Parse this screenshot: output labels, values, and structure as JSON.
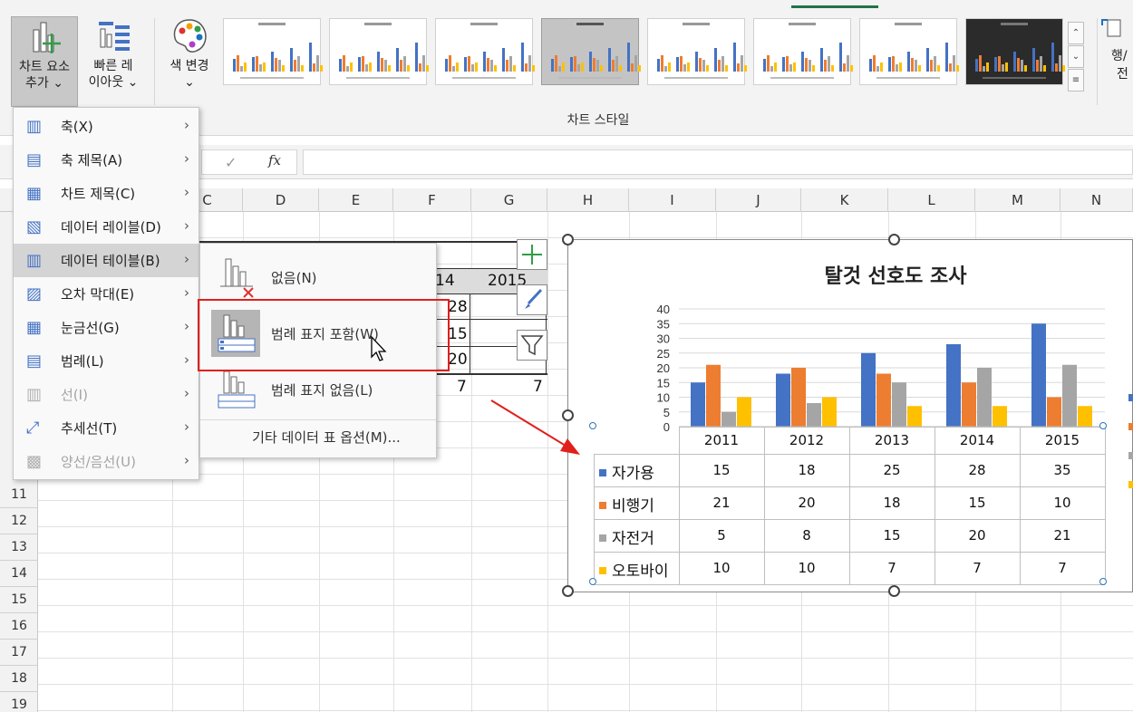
{
  "ribbon": {
    "add_element": {
      "line1": "차트 요소",
      "line2": "추가"
    },
    "quick_layout": {
      "line1": "빠른 레",
      "line2": "이아웃"
    },
    "color_change": {
      "label": "색 변경"
    },
    "group_label": "차트 스타일",
    "right_cut": {
      "line1": "행/",
      "line2": "전"
    }
  },
  "formula_bar": {
    "fx_label": "fx",
    "confirm_icon": "checkmark-icon"
  },
  "columns": [
    "C",
    "D",
    "E",
    "F",
    "G",
    "H",
    "I",
    "J",
    "K",
    "L",
    "M",
    "N"
  ],
  "rows": [
    "11",
    "12",
    "13",
    "14",
    "15",
    "16",
    "17",
    "18",
    "19"
  ],
  "source_table": {
    "headers": [
      "14",
      "2015"
    ],
    "col_a": [
      "28",
      "15",
      "20",
      "7"
    ],
    "col_b": [
      "7"
    ]
  },
  "dropdown_menu": {
    "items": [
      {
        "label": "축(X)",
        "icon": "axes-icon",
        "enabled": true
      },
      {
        "label": "축 제목(A)",
        "icon": "axis-title-icon",
        "enabled": true
      },
      {
        "label": "차트 제목(C)",
        "icon": "chart-title-icon",
        "enabled": true
      },
      {
        "label": "데이터 레이블(D)",
        "icon": "data-labels-icon",
        "enabled": true
      },
      {
        "label": "데이터 테이블(B)",
        "icon": "data-table-icon",
        "enabled": true,
        "highlighted": true
      },
      {
        "label": "오차 막대(E)",
        "icon": "error-bars-icon",
        "enabled": true
      },
      {
        "label": "눈금선(G)",
        "icon": "gridlines-icon",
        "enabled": true
      },
      {
        "label": "범례(L)",
        "icon": "legend-icon",
        "enabled": true
      },
      {
        "label": "선(I)",
        "icon": "lines-icon",
        "enabled": false
      },
      {
        "label": "추세선(T)",
        "icon": "trendline-icon",
        "enabled": true
      },
      {
        "label": "양선/음선(U)",
        "icon": "up-down-bars-icon",
        "enabled": false
      }
    ]
  },
  "submenu": {
    "items": [
      {
        "label": "없음(N)",
        "icon": "no-data-table-icon"
      },
      {
        "label": "범례 표지 포함(W)",
        "icon": "data-table-with-legend-keys-icon",
        "selected": true
      },
      {
        "label": "범례 표지 없음(L)",
        "icon": "data-table-no-legend-keys-icon"
      }
    ],
    "more_options": "기타 데이터 표 옵션(M)..."
  },
  "chart": {
    "title": "탈것 선호도 조사",
    "colors": {
      "자가용": "#4472c4",
      "비행기": "#ed7d31",
      "자전거": "#a5a5a5",
      "오토바이": "#ffc000"
    }
  },
  "chart_data": {
    "type": "bar",
    "title": "탈것 선호도 조사",
    "categories": [
      "2011",
      "2012",
      "2013",
      "2014",
      "2015"
    ],
    "series": [
      {
        "name": "자가용",
        "values": [
          15,
          18,
          25,
          28,
          35
        ]
      },
      {
        "name": "비행기",
        "values": [
          21,
          20,
          18,
          15,
          10
        ]
      },
      {
        "name": "자전거",
        "values": [
          5,
          8,
          15,
          20,
          21
        ]
      },
      {
        "name": "오토바이",
        "values": [
          10,
          10,
          7,
          7,
          7
        ]
      }
    ],
    "yticks": [
      "0",
      "5",
      "10",
      "15",
      "20",
      "25",
      "30",
      "35",
      "40"
    ],
    "ylim": [
      0,
      40
    ],
    "grid": true,
    "legend": "data-table"
  }
}
